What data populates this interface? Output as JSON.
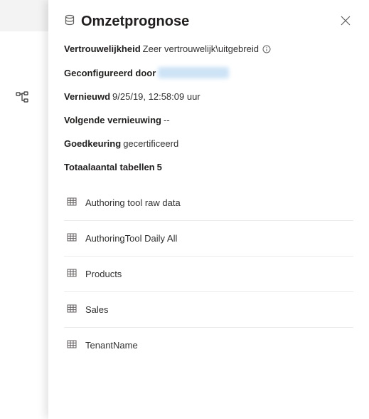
{
  "panel": {
    "title": "Omzetprognose",
    "meta": {
      "confidentiality_label": "Vertrouwelijkheid",
      "confidentiality_value": "Zeer vertrouwelijk\\uitgebreid",
      "configured_by_label": "Geconfigureerd door",
      "refreshed_label": "Vernieuwd",
      "refreshed_value": "9/25/19, 12:58:09 uur",
      "next_refresh_label": "Volgende vernieuwing",
      "next_refresh_value": "--",
      "approval_label": "Goedkeuring",
      "approval_value": "gecertificeerd",
      "table_count_label": "Totaalaantal tabellen",
      "table_count_value": "5"
    },
    "tables": [
      {
        "name": "Authoring tool raw data"
      },
      {
        "name": "AuthoringTool Daily All"
      },
      {
        "name": "Products"
      },
      {
        "name": "Sales"
      },
      {
        "name": "TenantName"
      }
    ]
  },
  "icons": {
    "dataset": "dataset-icon",
    "close": "close-icon",
    "info": "info-icon",
    "table": "table-icon",
    "lineage": "lineage-icon"
  }
}
